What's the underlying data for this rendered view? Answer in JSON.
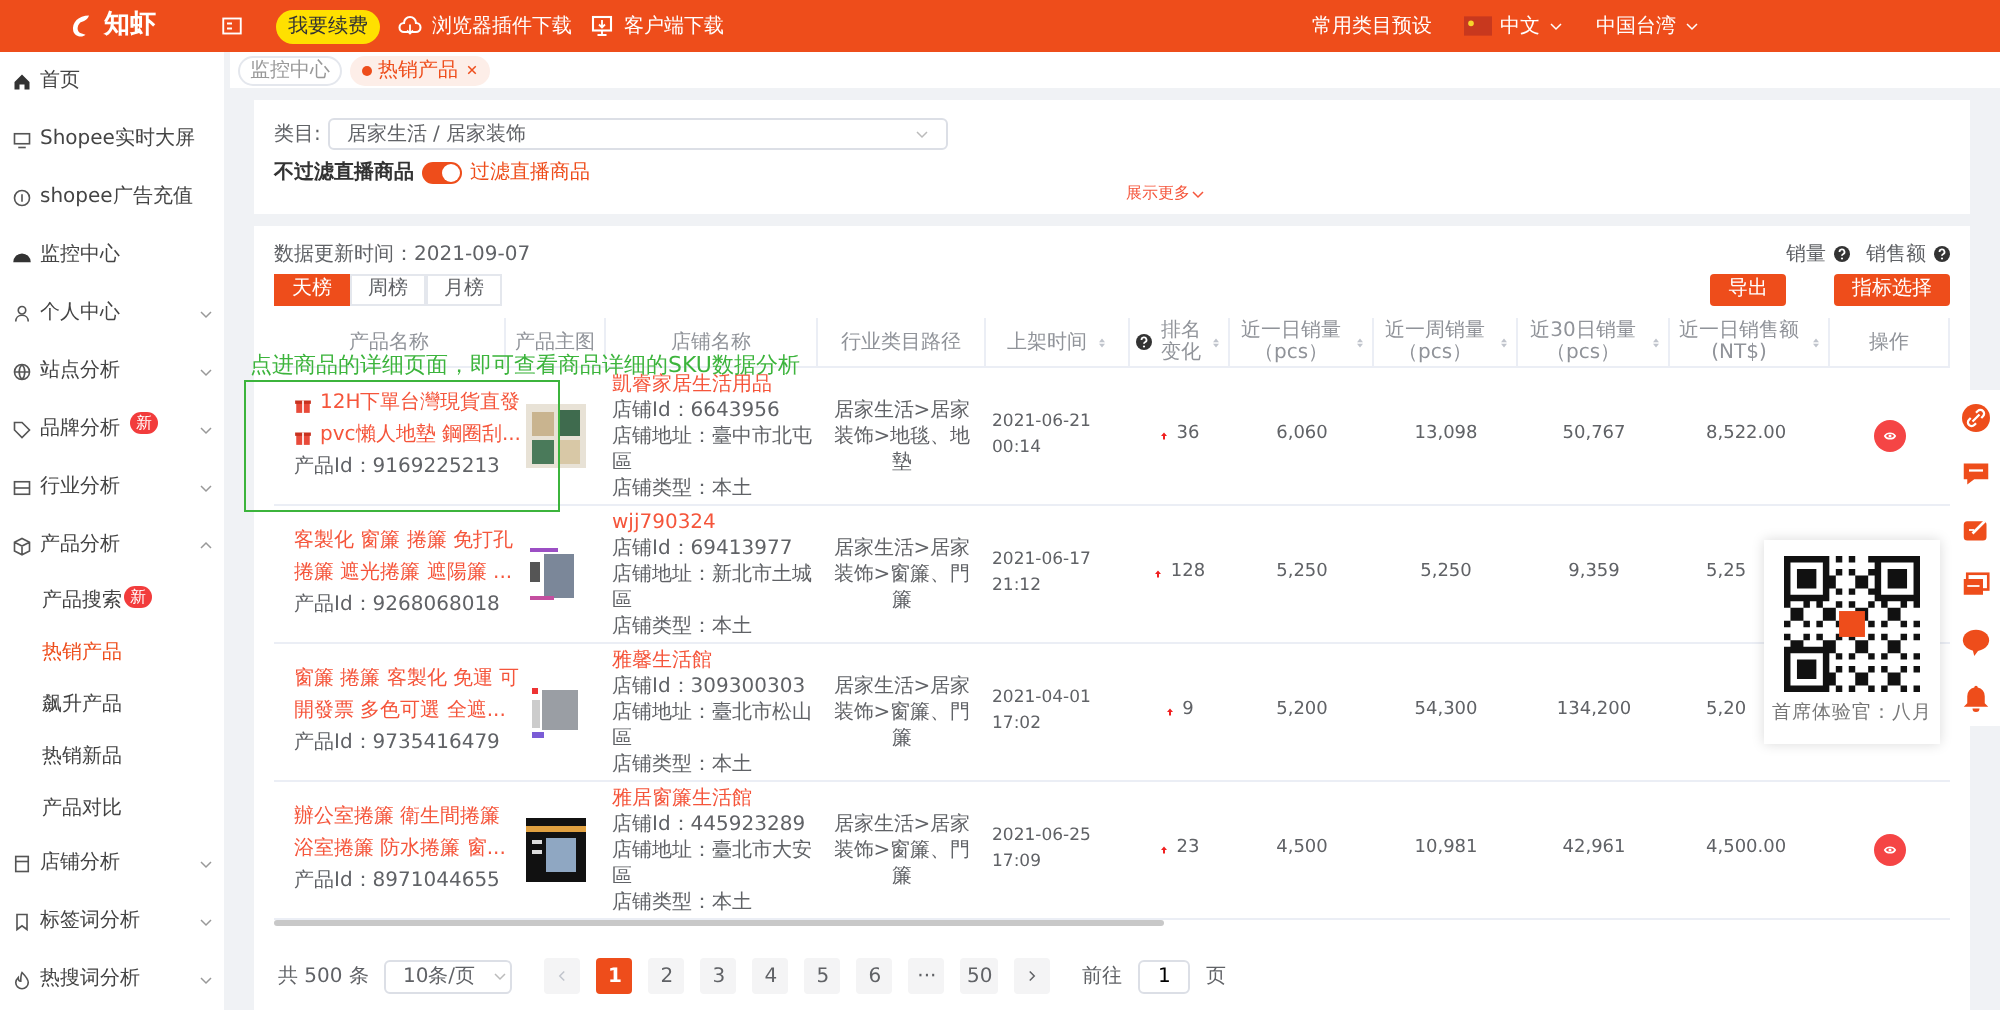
{
  "topbar": {
    "logo": "知虾",
    "renew_button": "我要续费",
    "links": [
      {
        "label": "浏览器插件下载"
      },
      {
        "label": "客户端下载"
      }
    ],
    "presets": "常用类目预设",
    "language": "中文",
    "region": "中国台湾"
  },
  "sidebar": {
    "items": [
      {
        "label": "首页"
      },
      {
        "label": "Shopee实时大屏"
      },
      {
        "label": "shopee广告充值"
      },
      {
        "label": "监控中心"
      },
      {
        "label": "个人中心",
        "expanded": false
      },
      {
        "label": "站点分析",
        "expanded": false
      },
      {
        "label": "品牌分析",
        "expanded": false,
        "badge": "新"
      },
      {
        "label": "行业分析",
        "expanded": false
      },
      {
        "label": "产品分析",
        "expanded": true,
        "children": [
          {
            "label": "产品搜索",
            "selected": false,
            "badge": "新"
          },
          {
            "label": "热销产品",
            "selected": true
          },
          {
            "label": "飙升产品",
            "selected": false
          },
          {
            "label": "热销新品",
            "selected": false
          },
          {
            "label": "产品对比",
            "selected": false
          }
        ]
      },
      {
        "label": "店铺分析",
        "expanded": false
      },
      {
        "label": "标签词分析",
        "expanded": false
      },
      {
        "label": "热搜词分析",
        "expanded": false
      }
    ]
  },
  "page_tabs": [
    {
      "label": "监控中心",
      "selected": false
    },
    {
      "label": "热销产品",
      "selected": true,
      "closable": true
    }
  ],
  "filter": {
    "category_label": "类目:",
    "category_value": "居家生活 / 居家装饰",
    "toggle_off_label": "不过滤直播商品",
    "toggle": {
      "on": true
    },
    "toggle_on_label": "过滤直播商品",
    "show_more": "展示更多"
  },
  "data": {
    "updated": "数据更新时间：2021-09-07",
    "metrics": [
      "销量",
      "销售额"
    ],
    "ranking_tabs": [
      {
        "label": "天榜",
        "selected": true
      },
      {
        "label": "周榜",
        "selected": false
      },
      {
        "label": "月榜",
        "selected": false
      }
    ],
    "buttons": [
      "导出",
      "指标选择"
    ],
    "columns": [
      {
        "label": "产品名称",
        "sortable": false,
        "help": false
      },
      {
        "label": "产品主图",
        "sortable": false,
        "help": false
      },
      {
        "label": "店铺名称",
        "sortable": false,
        "help": false
      },
      {
        "label": "行业类目路径",
        "sortable": false,
        "help": false
      },
      {
        "label": "上架时间",
        "sortable": true,
        "help": false
      },
      {
        "label": "排名变化",
        "sortable": true,
        "help": true
      },
      {
        "label": "近一日销量（pcs）",
        "sortable": true,
        "help": false
      },
      {
        "label": "近一周销量（pcs）",
        "sortable": true,
        "help": false
      },
      {
        "label": "近30日销量（pcs）",
        "sortable": true,
        "help": false
      },
      {
        "label": "近一日销售额(NT$)",
        "sortable": true,
        "help": false
      },
      {
        "label": "操作",
        "sortable": false,
        "help": false
      }
    ],
    "rows": [
      {
        "name_lines": [
          "12H下單台灣現貨直發",
          "pvc懶人地墊 鋼圈刮..."
        ],
        "gift_icons": true,
        "product_id": "产品Id：9169225213",
        "shop": "凱睿家居生活用品",
        "shop_id": "店铺Id：6643956",
        "shop_address": "店铺地址：臺中市北屯區",
        "shop_type": "店铺类型：本土",
        "category": "居家生活>居家装饰>地毯、地墊",
        "listed": "2021-06-21 00:14",
        "rank_change": "36",
        "rank_up": true,
        "day_sales": "6,060",
        "week_sales": "13,098",
        "month_sales": "50,767",
        "day_revenue": "8,522.00",
        "view_button": true
      },
      {
        "name_lines": [
          "客製化 窗簾 捲簾 免打孔",
          "捲簾 遮光捲簾 遮陽簾 ..."
        ],
        "gift_icons": false,
        "product_id": "产品Id：9268068018",
        "shop": "wjj790324",
        "shop_id": "店铺Id：69413977",
        "shop_address": "店铺地址：新北市土城區",
        "shop_type": "店铺类型：本土",
        "category": "居家生活>居家装饰>窗簾、門簾",
        "listed": "2021-06-17 21:12",
        "rank_change": "128",
        "rank_up": true,
        "day_sales": "5,250",
        "week_sales": "5,250",
        "month_sales": "9,359",
        "day_revenue": "5,25",
        "view_button": false
      },
      {
        "name_lines": [
          "窗簾 捲簾 客製化 免運 可",
          "開發票 多色可選 全遮..."
        ],
        "gift_icons": false,
        "product_id": "产品Id：9735416479",
        "shop": "雅馨生活館",
        "shop_id": "店铺Id：309300303",
        "shop_address": "店铺地址：臺北市松山區",
        "shop_type": "店铺类型：本土",
        "category": "居家生活>居家装饰>窗簾、門簾",
        "listed": "2021-04-01 17:02",
        "rank_change": "9",
        "rank_up": true,
        "day_sales": "5,200",
        "week_sales": "54,300",
        "month_sales": "134,200",
        "day_revenue": "5,20",
        "view_button": false
      },
      {
        "name_lines": [
          "辦公室捲簾 衛生間捲簾",
          "浴室捲簾 防水捲簾 窗..."
        ],
        "gift_icons": false,
        "product_id": "产品Id：8971044655",
        "shop": "雅居窗簾生活館",
        "shop_id": "店铺Id：445923289",
        "shop_address": "店铺地址：臺北市大安區",
        "shop_type": "店铺类型：本土",
        "category": "居家生活>居家装饰>窗簾、門簾",
        "listed": "2021-06-25 17:09",
        "rank_change": "23",
        "rank_up": true,
        "day_sales": "4,500",
        "week_sales": "10,981",
        "month_sales": "42,961",
        "day_revenue": "4,500.00",
        "view_button": true
      }
    ],
    "annotation": "点进商品的详细页面，即可查看商品详细的SKU数据分析"
  },
  "pagination": {
    "total": "共 500 条",
    "page_size": "10条/页",
    "pages": [
      {
        "label": "1",
        "selected": true
      },
      {
        "label": "2",
        "selected": false
      },
      {
        "label": "3",
        "selected": false
      },
      {
        "label": "4",
        "selected": false
      },
      {
        "label": "5",
        "selected": false
      },
      {
        "label": "6",
        "selected": false
      },
      {
        "label": "···",
        "selected": false
      },
      {
        "label": "50",
        "selected": false
      }
    ],
    "goto_label": "前往",
    "goto_value": "1",
    "goto_suffix": "页"
  },
  "qr_popup": {
    "caption": "首席体验官：八月"
  }
}
